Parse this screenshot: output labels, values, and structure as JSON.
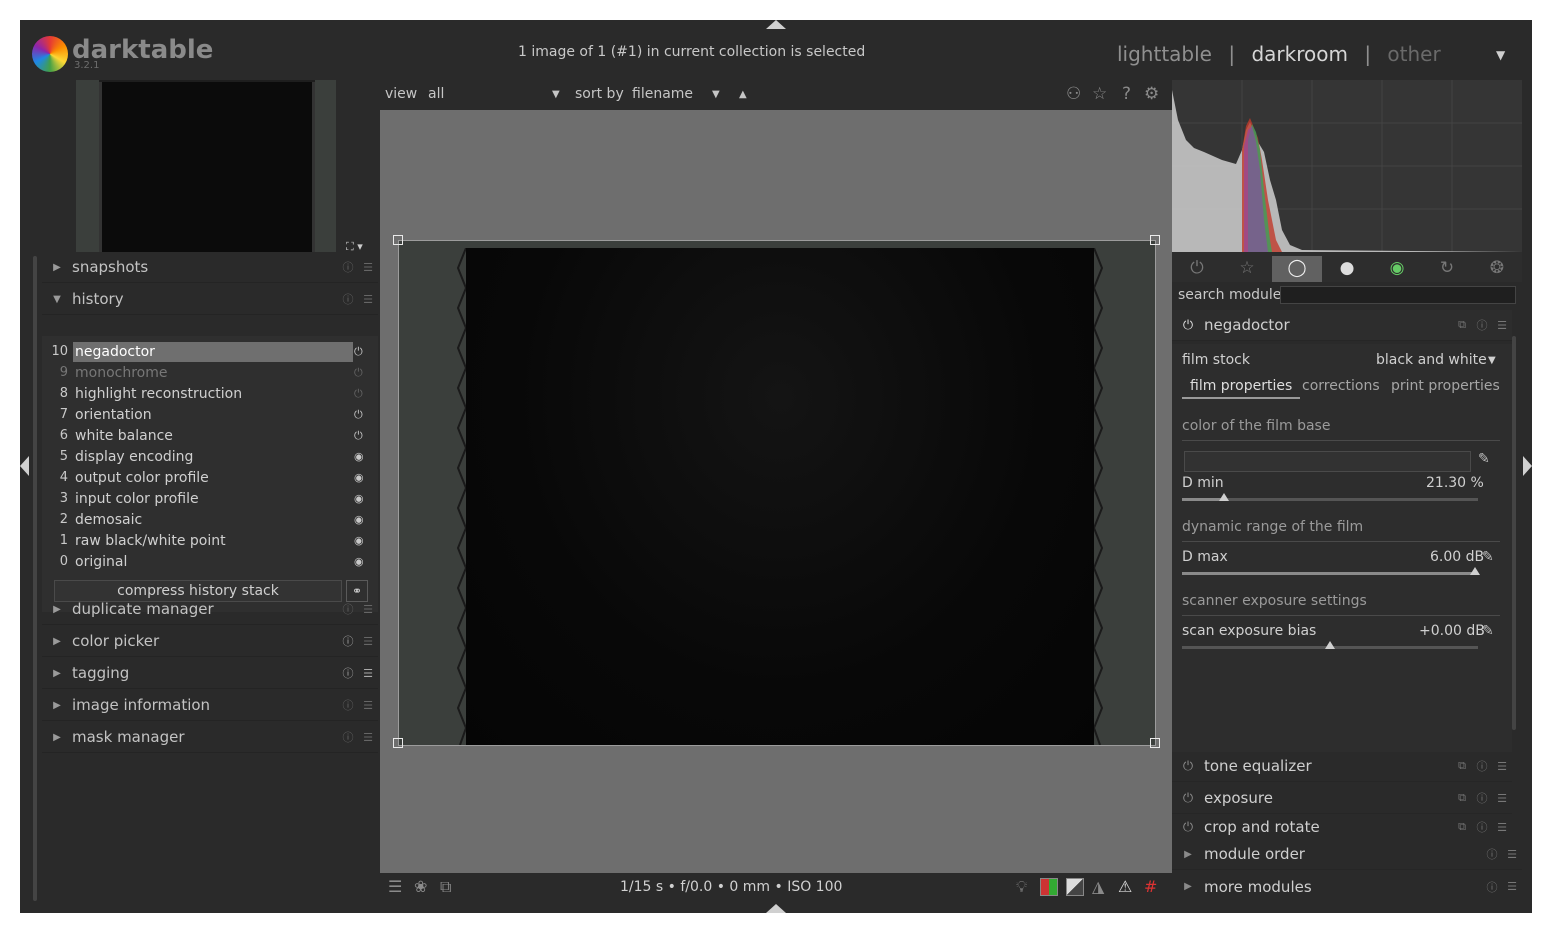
{
  "app": {
    "name": "darktable",
    "version": "3.2.1",
    "selection_status": "1 image of 1 (#1) in current collection is selected",
    "views": [
      "lighttable",
      "darkroom",
      "other"
    ],
    "active_view": "darkroom",
    "view_separator": "|"
  },
  "filmstrip_bar": {
    "view_label": "view",
    "view_value": "all",
    "sort_label": "sort by",
    "sort_value": "filename",
    "sort_direction": "▲"
  },
  "left_panel": {
    "modules": [
      {
        "label": "snapshots",
        "expanded": false
      },
      {
        "label": "history",
        "expanded": true
      },
      {
        "label": "duplicate manager",
        "expanded": false
      },
      {
        "label": "color picker",
        "expanded": false
      },
      {
        "label": "tagging",
        "expanded": false
      },
      {
        "label": "image information",
        "expanded": false
      },
      {
        "label": "mask manager",
        "expanded": false
      }
    ],
    "history": [
      {
        "num": "10",
        "label": "negadoctor",
        "selected": true
      },
      {
        "num": "9",
        "label": "monochrome",
        "dim": true
      },
      {
        "num": "8",
        "label": "highlight reconstruction"
      },
      {
        "num": "7",
        "label": "orientation"
      },
      {
        "num": "6",
        "label": "white balance"
      },
      {
        "num": "5",
        "label": "display encoding"
      },
      {
        "num": "4",
        "label": "output color profile"
      },
      {
        "num": "3",
        "label": "input color profile"
      },
      {
        "num": "2",
        "label": "demosaic"
      },
      {
        "num": "1",
        "label": "raw black/white point"
      },
      {
        "num": "0",
        "label": "original"
      }
    ],
    "compress_label": "compress history stack"
  },
  "bottom_bar": {
    "exif": "1/15 s • f/0.0 • 0 mm • ISO 100"
  },
  "right_panel": {
    "search_label": "search module",
    "search_value": "",
    "negadoctor": {
      "title": "negadoctor",
      "film_stock_label": "film stock",
      "film_stock_value": "black and white",
      "tabs": [
        "film properties",
        "corrections",
        "print properties"
      ],
      "section_base": "color of the film base",
      "dmin_label": "D min",
      "dmin_value": "21.30 %",
      "section_range": "dynamic range of the film",
      "dmax_label": "D max",
      "dmax_value": "6.00 dB",
      "section_scanner": "scanner exposure settings",
      "bias_label": "scan exposure bias",
      "bias_value": "+0.00 dB"
    },
    "modules_below": [
      "tone equalizer",
      "exposure",
      "crop and rotate"
    ],
    "footer_modules": [
      "module order",
      "more modules"
    ]
  },
  "colors": {
    "background": "#2a2a2a",
    "canvas": "#6e6e6e",
    "selected_history": "#6f6f6f"
  }
}
